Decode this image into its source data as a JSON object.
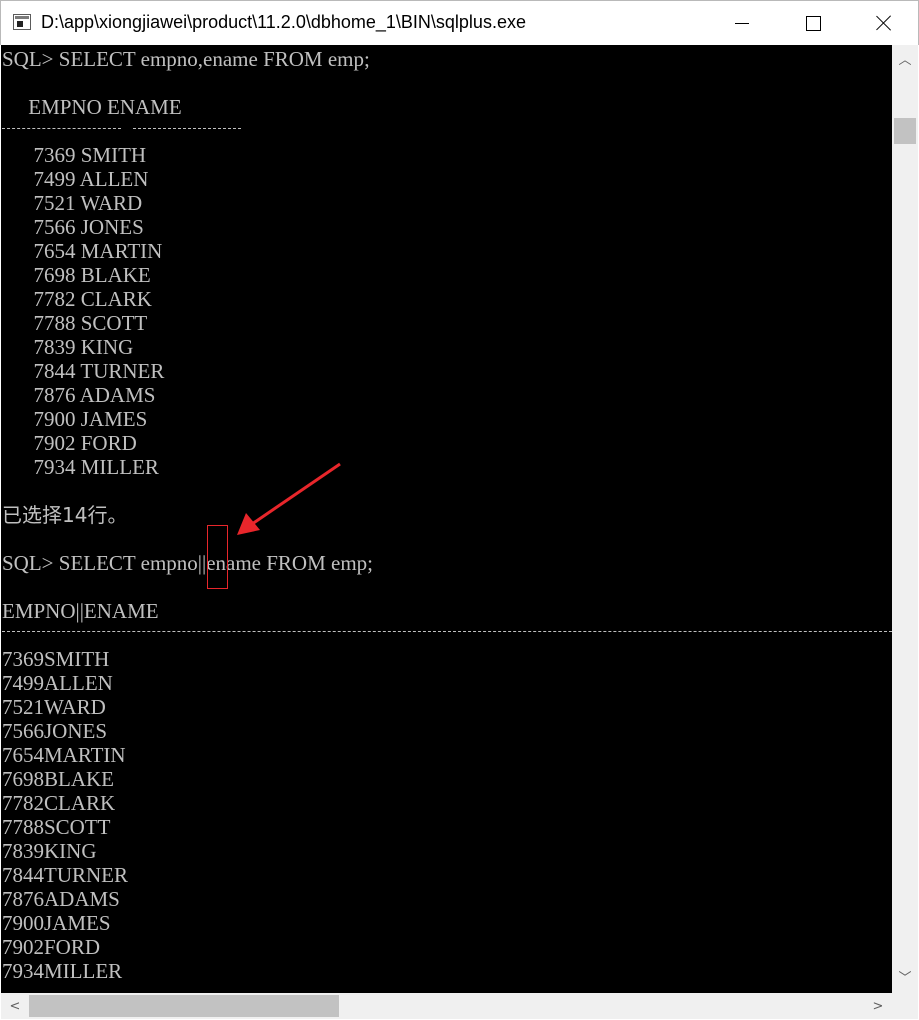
{
  "window": {
    "title": "D:\\app\\xiongjiawei\\product\\11.2.0\\dbhome_1\\BIN\\sqlplus.exe"
  },
  "console": {
    "query1": "SQL> SELECT empno,ename FROM emp;",
    "header1": "     EMPNO ENAME",
    "rows1": [
      "      7369 SMITH",
      "      7499 ALLEN",
      "      7521 WARD",
      "      7566 JONES",
      "      7654 MARTIN",
      "      7698 BLAKE",
      "      7782 CLARK",
      "      7788 SCOTT",
      "      7839 KING",
      "      7844 TURNER",
      "      7876 ADAMS",
      "      7900 JAMES",
      "      7902 FORD",
      "      7934 MILLER"
    ],
    "rows_selected": "已选择14行。",
    "query2": "SQL> SELECT empno||ename FROM emp;",
    "header2": "EMPNO||ENAME",
    "rows2": [
      "7369SMITH",
      "7499ALLEN",
      "7521WARD",
      "7566JONES",
      "7654MARTIN",
      "7698BLAKE",
      "7782CLARK",
      "7788SCOTT",
      "7839KING",
      "7844TURNER",
      "7876ADAMS",
      "7900JAMES",
      "7902FORD",
      "7934MILLER"
    ]
  },
  "colors": {
    "console_bg": "#000000",
    "console_text": "#c0c0c0",
    "annotation": "#e8262b"
  },
  "icons": {
    "app": "console-window-icon",
    "minimize": "minimize-icon",
    "maximize": "maximize-icon",
    "close": "close-icon"
  }
}
